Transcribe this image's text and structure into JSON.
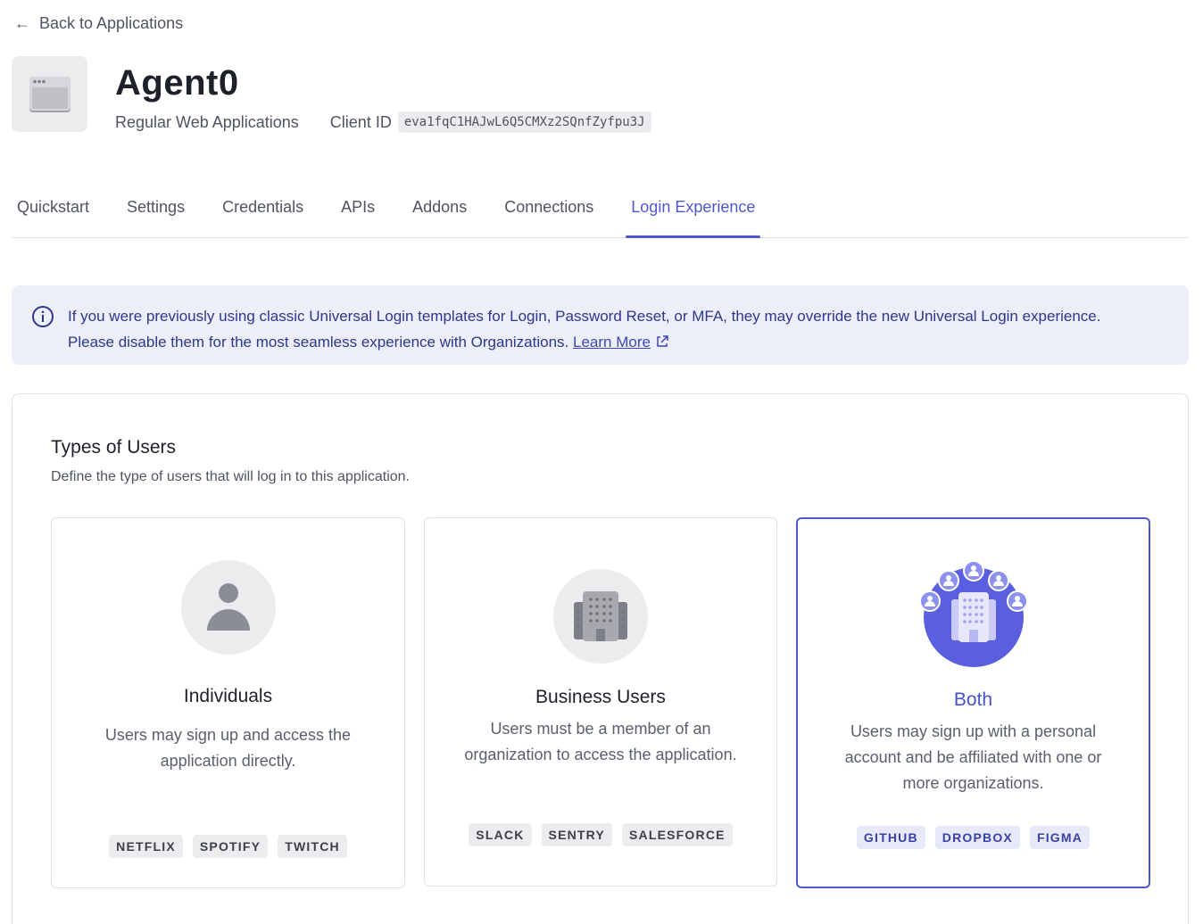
{
  "back_link": {
    "label": "Back to Applications"
  },
  "app": {
    "name": "Agent0",
    "type": "Regular Web Applications",
    "client_id_label": "Client ID",
    "client_id": "eva1fqC1HAJwL6Q5CMXz2SQnfZyfpu3J"
  },
  "tabs": [
    {
      "label": "Quickstart",
      "active": false
    },
    {
      "label": "Settings",
      "active": false
    },
    {
      "label": "Credentials",
      "active": false
    },
    {
      "label": "APIs",
      "active": false
    },
    {
      "label": "Addons",
      "active": false
    },
    {
      "label": "Connections",
      "active": false
    },
    {
      "label": "Login Experience",
      "active": true
    }
  ],
  "banner": {
    "text": "If you were previously using classic Universal Login templates for Login, Password Reset, or MFA, they may override the new Universal Login experience. Please disable them for the most seamless experience with Organizations.",
    "link": "Learn More"
  },
  "user_types": {
    "title": "Types of Users",
    "description": "Define the type of users that will log in to this application.",
    "options": [
      {
        "title": "Individuals",
        "description": "Users may sign up and access the application directly.",
        "tags": [
          "NETFLIX",
          "SPOTIFY",
          "TWITCH"
        ],
        "selected": false
      },
      {
        "title": "Business Users",
        "description": "Users must be a member of an organization to access the application.",
        "tags": [
          "SLACK",
          "SENTRY",
          "SALESFORCE"
        ],
        "selected": false
      },
      {
        "title": "Both",
        "description": "Users may sign up with a personal account and be affiliated with one or more organizations.",
        "tags": [
          "GITHUB",
          "DROPBOX",
          "FIGMA"
        ],
        "selected": true
      }
    ]
  },
  "colors": {
    "accent": "#5058c9",
    "banner_bg": "#eceef9",
    "selected_border": "#4f57cb"
  }
}
